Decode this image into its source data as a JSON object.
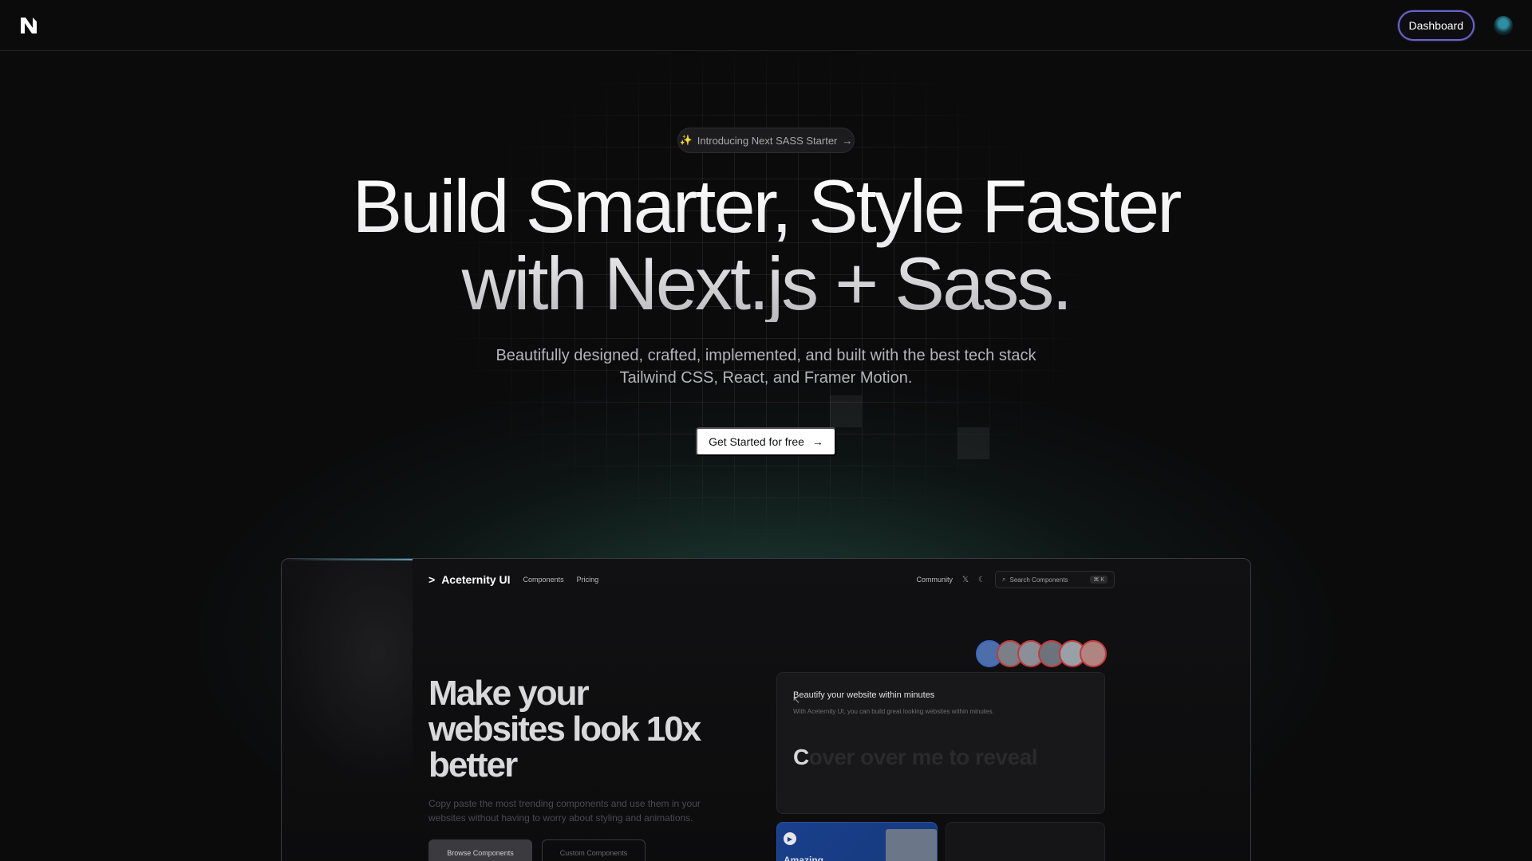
{
  "nav": {
    "logo_icon": "n-logo-icon",
    "dashboard_label": "Dashboard",
    "avatar_icon": "user-avatar-icon"
  },
  "hero": {
    "badge_icon": "sparkles-icon",
    "badge_label": "Introducing Next SASS Starter",
    "badge_arrow": "→",
    "title_line1": "Build Smarter, Style Faster",
    "title_line2": "with Next.js + Sass.",
    "subtitle_line1": "Beautifully designed, crafted, implemented, and built with the best tech stack",
    "subtitle_line2": "Tailwind CSS, React, and Framer Motion.",
    "cta_label": "Get Started for free",
    "cta_arrow": "→"
  },
  "preview": {
    "brand": "Aceternity UI",
    "brand_chevron": ">",
    "links": [
      "Components",
      "Pricing"
    ],
    "community": "Community",
    "x_icon": "x-logo-icon",
    "theme_icon": "moon-icon",
    "search_placeholder": "Search Components",
    "search_kbd": "⌘ K",
    "title": "Make your websites look 10x better",
    "description": "Copy paste the most trending components and use them in your websites without having to worry about styling and animations.",
    "browse_label": "Browse Components",
    "custom_label": "Custom Components",
    "card_title": "Beautify your website within minutes",
    "card_text": "With Aceternity UI, you can build great looking websites within minutes.",
    "card_reveal_first": "C",
    "card_reveal_rest": "over over me to reveal",
    "mini_label": "Amazing"
  },
  "colors": {
    "background": "#0b0b0c",
    "glow": "#306e5f",
    "dashboard_border": "#6b63c9",
    "cta_bg": "#ffffff"
  }
}
